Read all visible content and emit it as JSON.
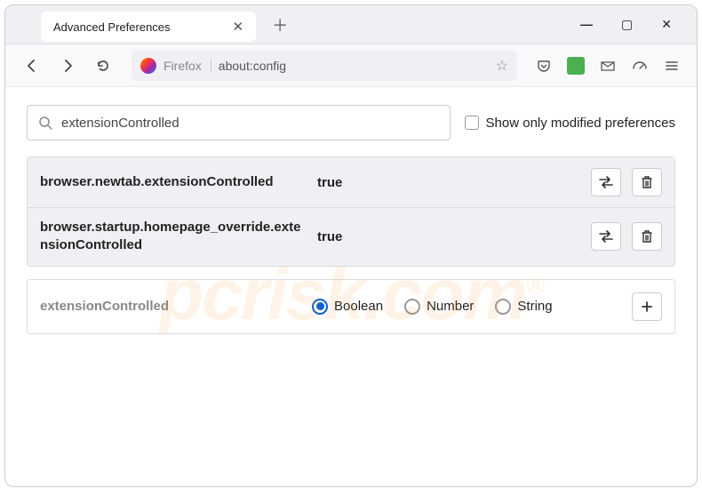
{
  "window": {
    "tab_title": "Advanced Preferences"
  },
  "urlbar": {
    "browser_label": "Firefox",
    "url": "about:config"
  },
  "search": {
    "value": "extensionControlled",
    "checkbox_label": "Show only modified preferences"
  },
  "prefs": [
    {
      "name": "browser.newtab.extensionControlled",
      "value": "true"
    },
    {
      "name": "browser.startup.homepage_override.extensionControlled",
      "value": "true"
    }
  ],
  "new_pref": {
    "name": "extensionControlled",
    "types": [
      "Boolean",
      "Number",
      "String"
    ],
    "selected": "Boolean"
  },
  "watermark": "pcrisk.com"
}
